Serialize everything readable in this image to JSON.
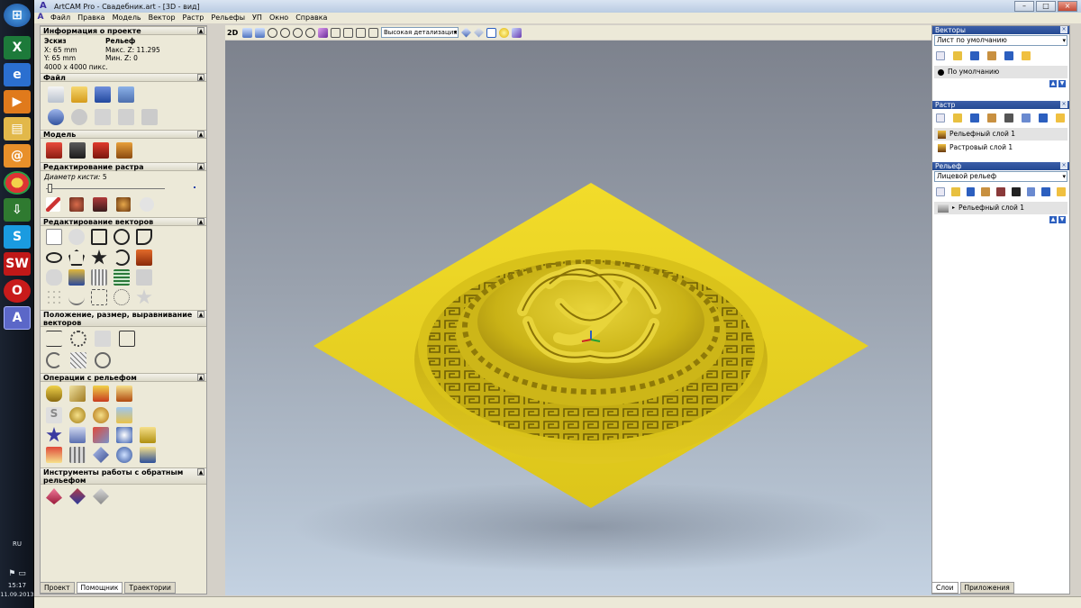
{
  "app": {
    "title": "ArtCAM Pro - Свадебник.art - [3D - вид]",
    "logo": "A",
    "window_controls": [
      "–",
      "□",
      "×"
    ]
  },
  "menu": [
    "Файл",
    "Правка",
    "Модель",
    "Вектор",
    "Растр",
    "Рельефы",
    "УП",
    "Окно",
    "Справка"
  ],
  "taskbar": {
    "language": "RU",
    "time": "15:17",
    "date": "11.09.2013",
    "icons": [
      "windows-start-icon",
      "excel-icon",
      "internet-explorer-icon",
      "media-player-icon",
      "folder-icon",
      "mail-agent-icon",
      "chrome-icon",
      "download-icon",
      "skype-icon",
      "solidworks-icon",
      "opera-icon",
      "artcam-icon"
    ]
  },
  "left_panel": {
    "project_info": {
      "header": "Информация о проекте",
      "col1_title": "Эскиз",
      "col2_title": "Рельеф",
      "x": "X: 65 mm",
      "y": "Y: 65 mm",
      "size_px": "4000 x 4000 пикс.",
      "max_z": "Макс. Z: 11.295",
      "min_z": "Мин. Z: 0"
    },
    "sections": {
      "file": "Файл",
      "model": "Модель",
      "raster_edit": "Редактирование растра",
      "vector_edit": "Редактирование векторов",
      "position": "Положение, размер, выравнивание векторов",
      "relief_ops": "Операции с рельефом",
      "reverse_tools": "Инструменты работы с обратным рельефом"
    },
    "brush_label": "Диаметр кисти:",
    "brush_value": "5",
    "tabs": [
      "Проект",
      "Помощник",
      "Траектории"
    ]
  },
  "view_toolbar": {
    "mode_2d": "2D",
    "detail_level": "Высокая детализация"
  },
  "right_panel": {
    "vectors": {
      "header": "Векторы",
      "sheet": "Лист по умолчанию",
      "default_layer": "По умолчанию"
    },
    "raster": {
      "header": "Растр",
      "layer1": "Рельефный слой 1",
      "layer2": "Растровый слой 1"
    },
    "relief": {
      "header": "Рельеф",
      "side": "Лицевой рельеф",
      "layer1": "Рельефный слой 1"
    },
    "tabs": [
      "Слои",
      "Приложения"
    ]
  },
  "colors": {
    "relief_gold": "#d9c21a",
    "plate_gold": "#e8d21d",
    "title_blue": "#254a93"
  }
}
